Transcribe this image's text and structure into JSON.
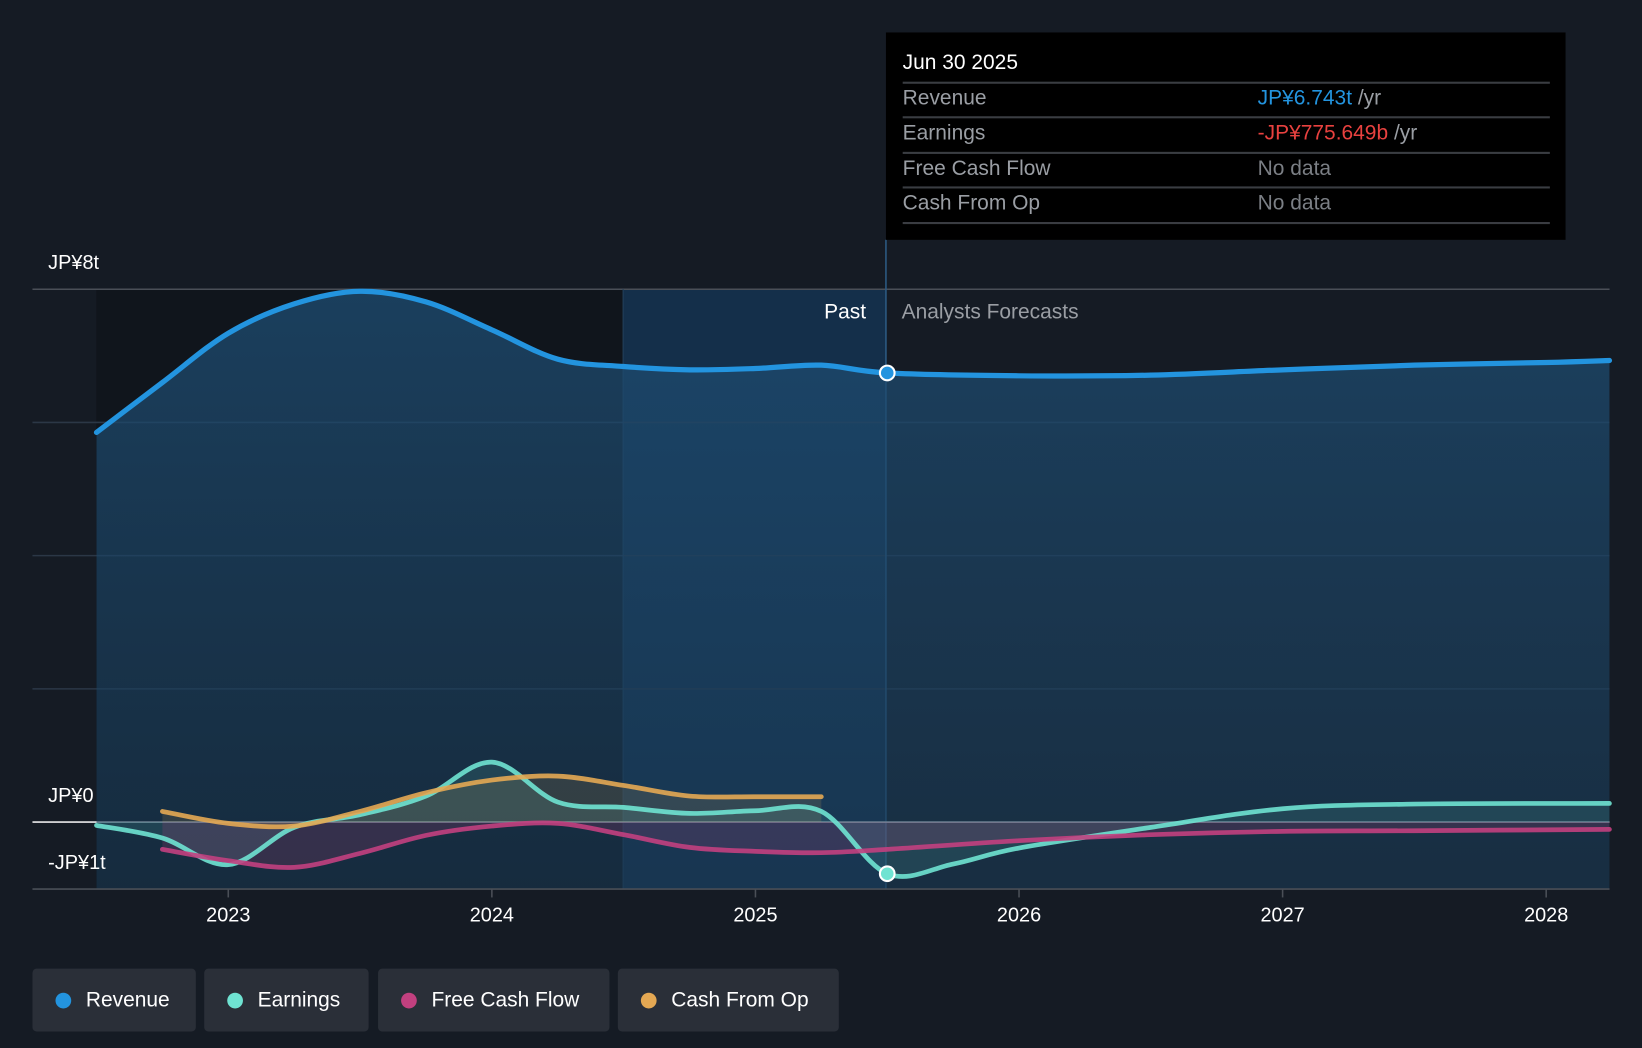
{
  "chart_data": {
    "type": "line",
    "x_ticks": [
      "2023",
      "2024",
      "2025",
      "2026",
      "2027",
      "2028"
    ],
    "y_ticks": [
      "JP¥8t",
      "JP¥0",
      "-JP¥1t"
    ],
    "ylim_trillions": [
      -1,
      8
    ],
    "xlim_years": [
      2022.5,
      2028.24
    ],
    "grid": true,
    "past_label": "Past",
    "forecast_label": "Analysts Forecasts",
    "divider_date": 2025.5,
    "series": [
      {
        "name": "Revenue",
        "color": "#2394df",
        "x": [
          2022.5,
          2022.75,
          2023,
          2023.25,
          2023.5,
          2023.75,
          2024,
          2024.25,
          2024.5,
          2024.75,
          2025,
          2025.25,
          2025.5,
          2026,
          2026.5,
          2027,
          2027.5,
          2028,
          2028.24
        ],
        "y": [
          5.85,
          6.6,
          7.34,
          7.78,
          7.97,
          7.81,
          7.39,
          6.95,
          6.84,
          6.79,
          6.81,
          6.86,
          6.743,
          6.7,
          6.71,
          6.79,
          6.86,
          6.9,
          6.93
        ]
      },
      {
        "name": "Earnings",
        "color": "#6fe3d2",
        "x": [
          2022.5,
          2022.75,
          2023,
          2023.25,
          2023.5,
          2023.75,
          2024,
          2024.25,
          2024.5,
          2024.75,
          2025,
          2025.25,
          2025.5,
          2025.75,
          2026,
          2026.5,
          2027,
          2027.5,
          2028.24
        ],
        "y": [
          -0.05,
          -0.24,
          -0.64,
          -0.08,
          0.11,
          0.39,
          0.9,
          0.3,
          0.22,
          0.13,
          0.17,
          0.16,
          -0.776,
          -0.63,
          -0.39,
          -0.08,
          0.2,
          0.27,
          0.28
        ]
      },
      {
        "name": "Free Cash Flow",
        "color": "#c2407f",
        "x": [
          2022.75,
          2023,
          2023.25,
          2023.5,
          2023.75,
          2024,
          2024.25,
          2024.5,
          2024.75,
          2025,
          2025.25,
          2025.5,
          2026,
          2026.5,
          2027,
          2027.5,
          2028.24
        ],
        "y": [
          -0.41,
          -0.58,
          -0.68,
          -0.47,
          -0.2,
          -0.06,
          -0.02,
          -0.19,
          -0.38,
          -0.44,
          -0.46,
          -0.41,
          -0.28,
          -0.19,
          -0.14,
          -0.13,
          -0.11
        ]
      },
      {
        "name": "Cash From Op",
        "color": "#e4a853",
        "x": [
          2022.75,
          2023,
          2023.25,
          2023.5,
          2023.75,
          2024,
          2024.25,
          2024.5,
          2024.75,
          2025,
          2025.25
        ],
        "y": [
          0.16,
          -0.02,
          -0.06,
          0.16,
          0.44,
          0.63,
          0.69,
          0.55,
          0.39,
          0.38,
          0.38
        ]
      }
    ]
  },
  "tooltip": {
    "date": "Jun 30 2025",
    "rows": [
      {
        "label": "Revenue",
        "value": "JP¥6.743t",
        "unit": "/yr",
        "color": "#2394df"
      },
      {
        "label": "Earnings",
        "value": "-JP¥775.649b",
        "unit": "/yr",
        "color": "#e8413f"
      },
      {
        "label": "Free Cash Flow",
        "value": "No data",
        "unit": "",
        "color": "#7b7f85"
      },
      {
        "label": "Cash From Op",
        "value": "No data",
        "unit": "",
        "color": "#7b7f85"
      }
    ]
  },
  "legend": [
    "Revenue",
    "Earnings",
    "Free Cash Flow",
    "Cash From Op"
  ]
}
